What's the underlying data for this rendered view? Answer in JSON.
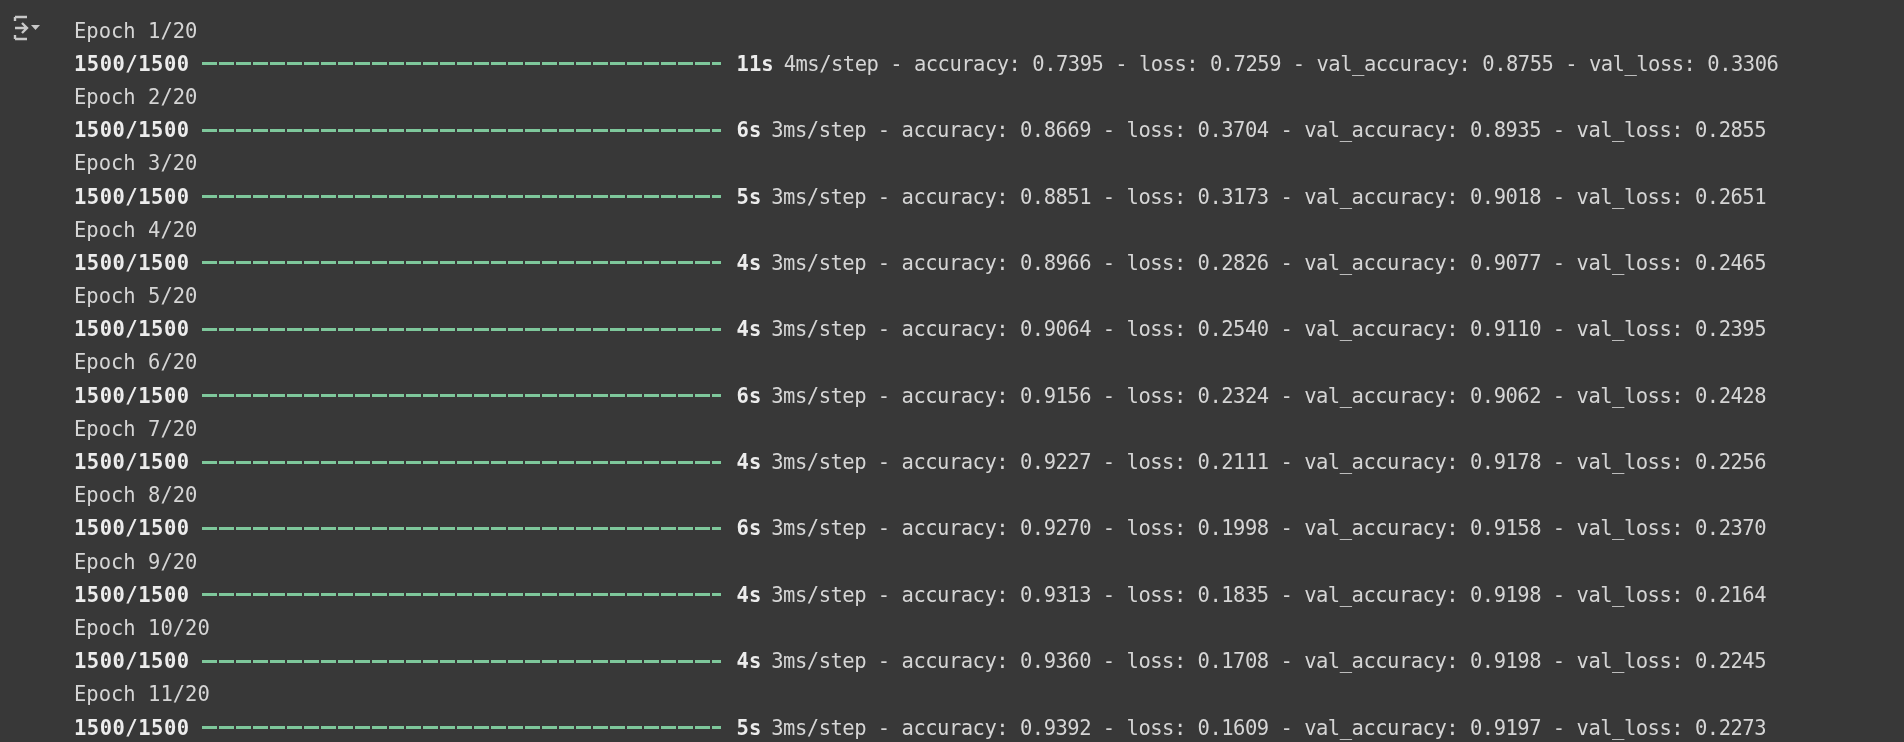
{
  "epochs": [
    {
      "label": "Epoch 1/20",
      "step": "1500/1500",
      "level": 1,
      "time": "11s",
      "details": "4ms/step - accuracy: 0.7395 - loss: 0.7259 - val_accuracy: 0.8755 - val_loss: 0.3306"
    },
    {
      "label": "Epoch 2/20",
      "step": "1500/1500",
      "level": 1,
      "time": "6s",
      "details": "3ms/step - accuracy: 0.8669 - loss: 0.3704 - val_accuracy: 0.8935 - val_loss: 0.2855"
    },
    {
      "label": "Epoch 3/20",
      "step": "1500/1500",
      "level": 1,
      "time": "5s",
      "details": "3ms/step - accuracy: 0.8851 - loss: 0.3173 - val_accuracy: 0.9018 - val_loss: 0.2651"
    },
    {
      "label": "Epoch 4/20",
      "step": "1500/1500",
      "level": 1,
      "time": "4s",
      "details": "3ms/step - accuracy: 0.8966 - loss: 0.2826 - val_accuracy: 0.9077 - val_loss: 0.2465"
    },
    {
      "label": "Epoch 5/20",
      "step": "1500/1500",
      "level": 1,
      "time": "4s",
      "details": "3ms/step - accuracy: 0.9064 - loss: 0.2540 - val_accuracy: 0.9110 - val_loss: 0.2395"
    },
    {
      "label": "Epoch 6/20",
      "step": "1500/1500",
      "level": 1,
      "time": "6s",
      "details": "3ms/step - accuracy: 0.9156 - loss: 0.2324 - val_accuracy: 0.9062 - val_loss: 0.2428"
    },
    {
      "label": "Epoch 7/20",
      "step": "1500/1500",
      "level": 1,
      "time": "4s",
      "details": "3ms/step - accuracy: 0.9227 - loss: 0.2111 - val_accuracy: 0.9178 - val_loss: 0.2256"
    },
    {
      "label": "Epoch 8/20",
      "step": "1500/1500",
      "level": 1,
      "time": "6s",
      "details": "3ms/step - accuracy: 0.9270 - loss: 0.1998 - val_accuracy: 0.9158 - val_loss: 0.2370"
    },
    {
      "label": "Epoch 9/20",
      "step": "1500/1500",
      "level": 1,
      "time": "4s",
      "details": "3ms/step - accuracy: 0.9313 - loss: 0.1835 - val_accuracy: 0.9198 - val_loss: 0.2164"
    },
    {
      "label": "Epoch 10/20",
      "step": "1500/1500",
      "level": 1,
      "time": "4s",
      "details": "3ms/step - accuracy: 0.9360 - loss: 0.1708 - val_accuracy: 0.9198 - val_loss: 0.2245"
    },
    {
      "label": "Epoch 11/20",
      "step": "1500/1500",
      "level": 1,
      "time": "5s",
      "details": "3ms/step - accuracy: 0.9392 - loss: 0.1609 - val_accuracy: 0.9197 - val_loss: 0.2273"
    }
  ]
}
